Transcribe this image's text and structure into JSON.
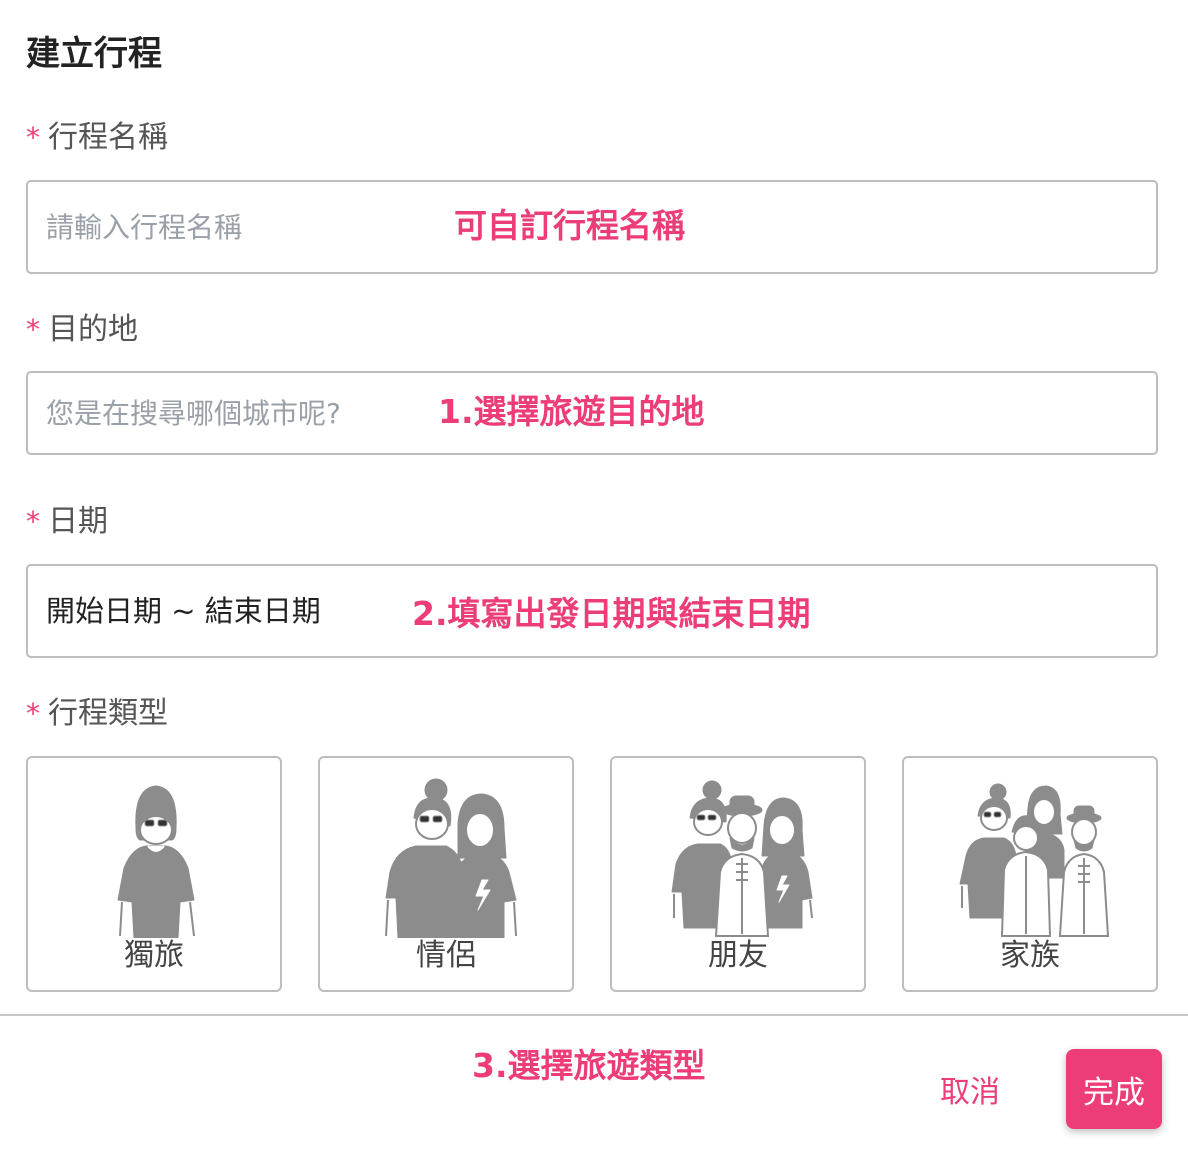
{
  "dialog": {
    "title": "建立行程"
  },
  "fields": {
    "required_mark": "*",
    "trip_name": {
      "label": "行程名稱",
      "placeholder": "請輸入行程名稱"
    },
    "destination": {
      "label": "目的地",
      "placeholder": "您是在搜尋哪個城市呢?"
    },
    "date": {
      "label": "日期",
      "value": "開始日期 ~ 結束日期"
    },
    "trip_type": {
      "label": "行程類型",
      "options": [
        {
          "label": "獨旅",
          "icon": "solo-traveler-icon"
        },
        {
          "label": "情侶",
          "icon": "couple-icon"
        },
        {
          "label": "朋友",
          "icon": "friends-group-icon"
        },
        {
          "label": "家族",
          "icon": "family-group-icon"
        }
      ]
    }
  },
  "annotations": {
    "name_note": "可自訂行程名稱",
    "destination_note": "1.選擇旅遊目的地",
    "date_note": "2.填寫出發日期與結束日期",
    "type_note": "3.選擇旅遊類型"
  },
  "footer": {
    "cancel_label": "取消",
    "done_label": "完成"
  },
  "colors": {
    "accent": "#ec3d78",
    "border": "#bdbdbd",
    "illustration": "#8c8c8c"
  }
}
